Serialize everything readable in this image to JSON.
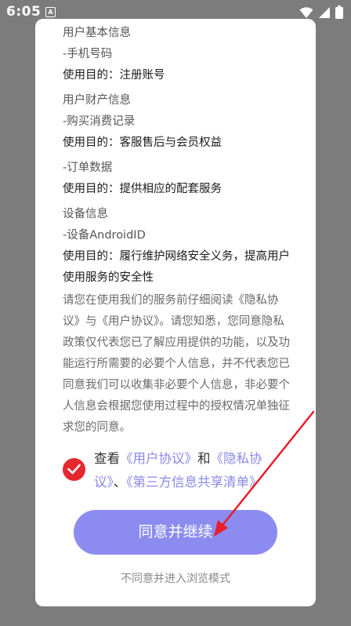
{
  "status_bar": {
    "time": "6:05",
    "notification_glyph": "A",
    "icons": [
      "wifi-icon",
      "signal-icon",
      "battery-icon"
    ]
  },
  "sections": [
    {
      "title": "用户基本信息",
      "item": "-手机号码",
      "purpose": "使用目的：注册账号"
    },
    {
      "title": "用户财产信息",
      "item": "-购买消费记录",
      "purpose": "使用目的：客服售后与会员权益"
    },
    {
      "title": "",
      "item": "-订单数据",
      "purpose": "使用目的：提供相应的配套服务"
    },
    {
      "title": "设备信息",
      "item": "-设备AndroidID",
      "purpose_line1": "使用目的：履行维护网络安全义务，提高用户",
      "purpose_line2": "使用服务的安全性"
    }
  ],
  "notice_lines": [
    "请您在使用我们的服务前仔细阅读《隐私协",
    "议》与《用户协议》。请您知悉，您同意隐私",
    "政策仅代表您已了解应用提供的功能，以及功",
    "能运行所需要的必要个人信息，并不代表您已",
    "同意我们可以收集非必要个人信息，非必要个",
    "人信息会根据您使用过程中的授权情况单独征",
    "求您的同意。"
  ],
  "agreement": {
    "checked": true,
    "prefix": "查看",
    "link_user": "《用户协议》",
    "conj1": "和",
    "link_privacy_a": "《隐私协",
    "link_privacy_b": "议》",
    "conj2": "、",
    "link_third_party": "《第三方信息共享清单》"
  },
  "agree_button_label": "同意并继续",
  "browse_mode_label": "不同意并进入浏览模式",
  "colors": {
    "accent": "#8c8cf0",
    "link": "#8b88e8",
    "check": "#e4282e",
    "annotation_arrow": "#e8202a"
  }
}
